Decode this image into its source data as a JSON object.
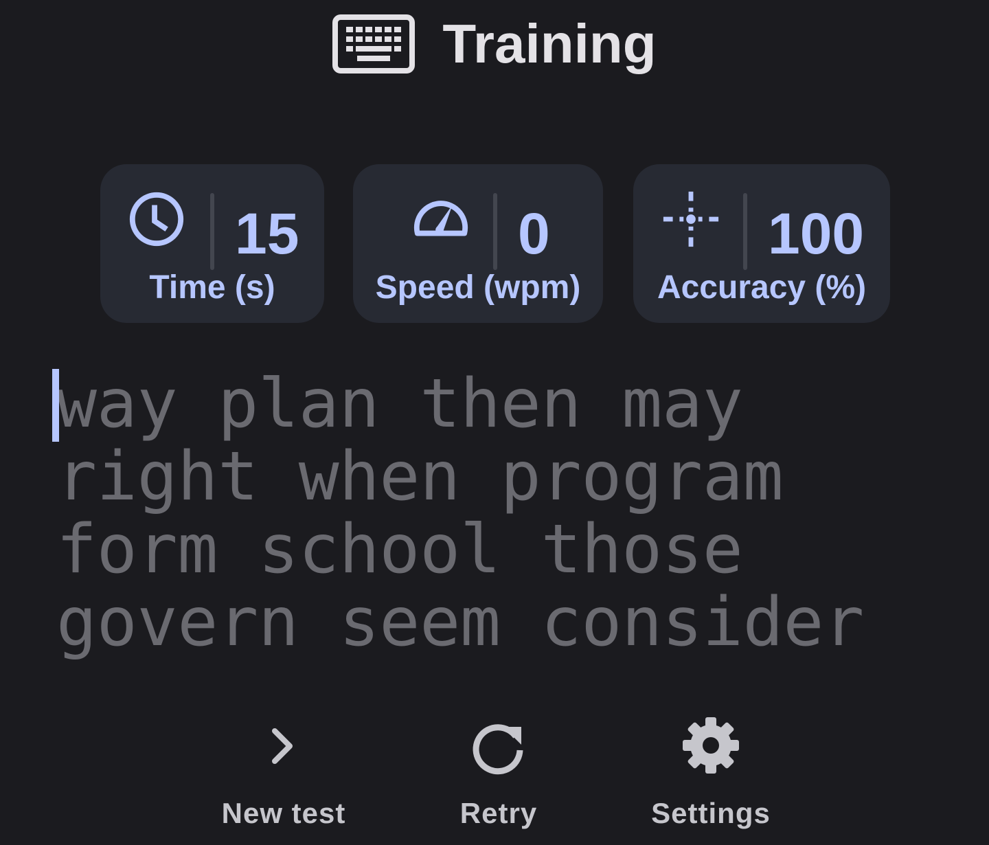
{
  "header": {
    "icon": "keyboard-icon",
    "title": "Training"
  },
  "stats": [
    {
      "icon": "clock-icon",
      "value": "15",
      "label": "Time (s)"
    },
    {
      "icon": "speedometer-icon",
      "value": "0",
      "label": "Speed (wpm)"
    },
    {
      "icon": "crosshair-icon",
      "value": "100",
      "label": "Accuracy (%)"
    }
  ],
  "typing": {
    "lines": [
      "way plan then may",
      "right when program",
      "form school those",
      "govern seem consider"
    ]
  },
  "actions": [
    {
      "icon": "chevron-right-icon",
      "label": "New test"
    },
    {
      "icon": "refresh-icon",
      "label": "Retry"
    },
    {
      "icon": "gear-icon",
      "label": "Settings"
    }
  ],
  "colors": {
    "background": "#1b1b1f",
    "card": "#272a33",
    "accent": "#b6c6ff",
    "pending_text": "#6a6a70",
    "action": "#c6c6cc"
  }
}
